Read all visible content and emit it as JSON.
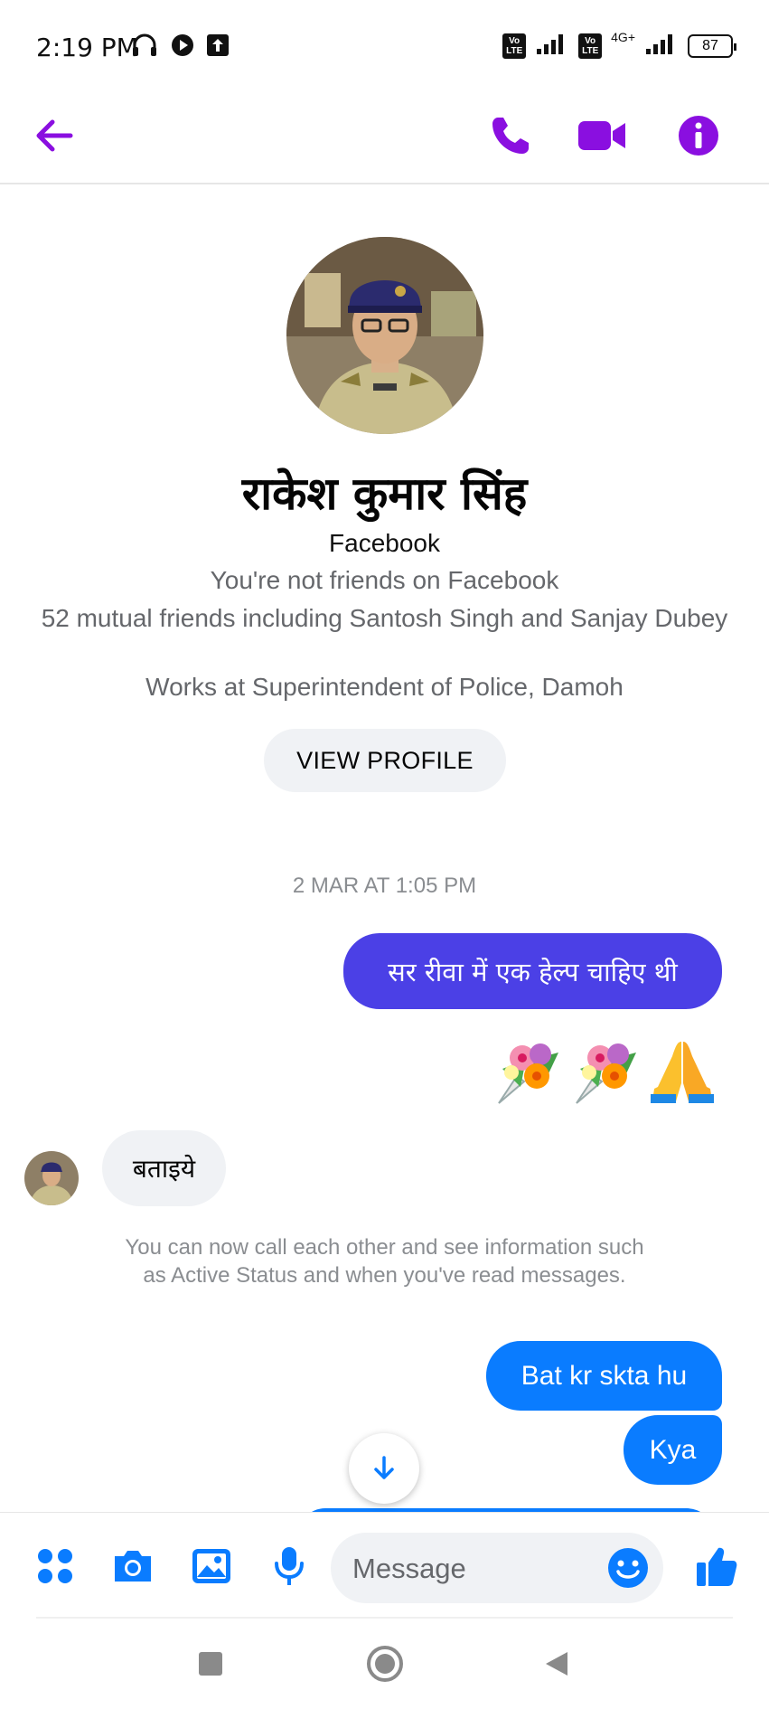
{
  "status_bar": {
    "time": "2:19 PM",
    "network_label": "4G+",
    "volte_label": "Vo LTE",
    "battery": "87"
  },
  "header": {
    "accent_color": "#8a0fe0",
    "back_icon": "arrow-left-icon",
    "call_icon": "phone-icon",
    "video_icon": "video-camera-icon",
    "info_icon": "info-icon"
  },
  "profile": {
    "name": "राकेश कुमार सिंह",
    "source": "Facebook",
    "friend_status": "You're not friends on Facebook",
    "mutual_friends": "52 mutual friends including Santosh Singh and Sanjay Dubey",
    "works_at": "Works at Superintendent of Police, Damoh",
    "view_profile_label": "VIEW PROFILE"
  },
  "conversation": {
    "timestamp": "2 MAR AT 1:05 PM",
    "messages": [
      {
        "direction": "outgoing",
        "text": "सर रीवा में एक हेल्प चाहिए थी"
      },
      {
        "direction": "outgoing",
        "type": "emoji",
        "emojis": [
          "bouquet",
          "bouquet",
          "folded-hands"
        ]
      },
      {
        "direction": "incoming",
        "text": "बताइये"
      },
      {
        "direction": "outgoing",
        "text": "Bat kr skta hu"
      },
      {
        "direction": "outgoing",
        "text": "Kya"
      }
    ],
    "system_note": "You can now call each other and see information such as Active Status and when you've read messages."
  },
  "composer": {
    "placeholder": "Message",
    "accent_color": "#0a7cff"
  }
}
